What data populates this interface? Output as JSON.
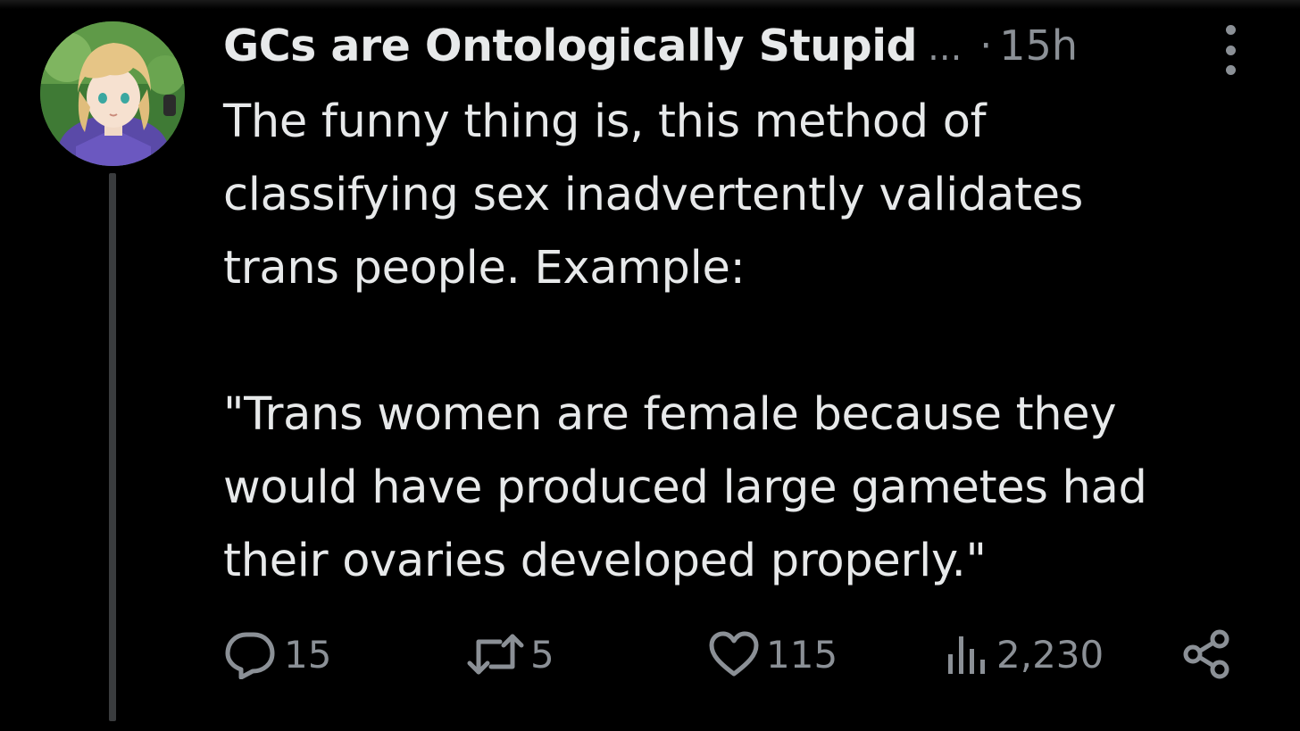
{
  "tweet": {
    "display_name": "GCs are Ontologically Stupid",
    "truncation": "...",
    "separator": "·",
    "time_ago": "15h",
    "text": "The funny thing is, this method of\nclassifying sex inadvertently validates\ntrans people.  Example:\n\n\"Trans women are female because they\nwould have produced large gametes had\ntheir ovaries developed properly.\""
  },
  "actions": {
    "replies": "15",
    "retweets": "5",
    "likes": "115",
    "views": "2,230"
  },
  "icons": {
    "reply": "speech-bubble-icon",
    "retweet": "retweet-arrows-icon",
    "like": "heart-icon",
    "views": "bar-chart-icon",
    "share": "share-nodes-icon",
    "more": "vertical-ellipsis-icon"
  },
  "colors": {
    "background": "#000000",
    "text_primary": "#e7e9ea",
    "text_secondary": "#8b9096",
    "thread_line": "#3a3c3e"
  }
}
